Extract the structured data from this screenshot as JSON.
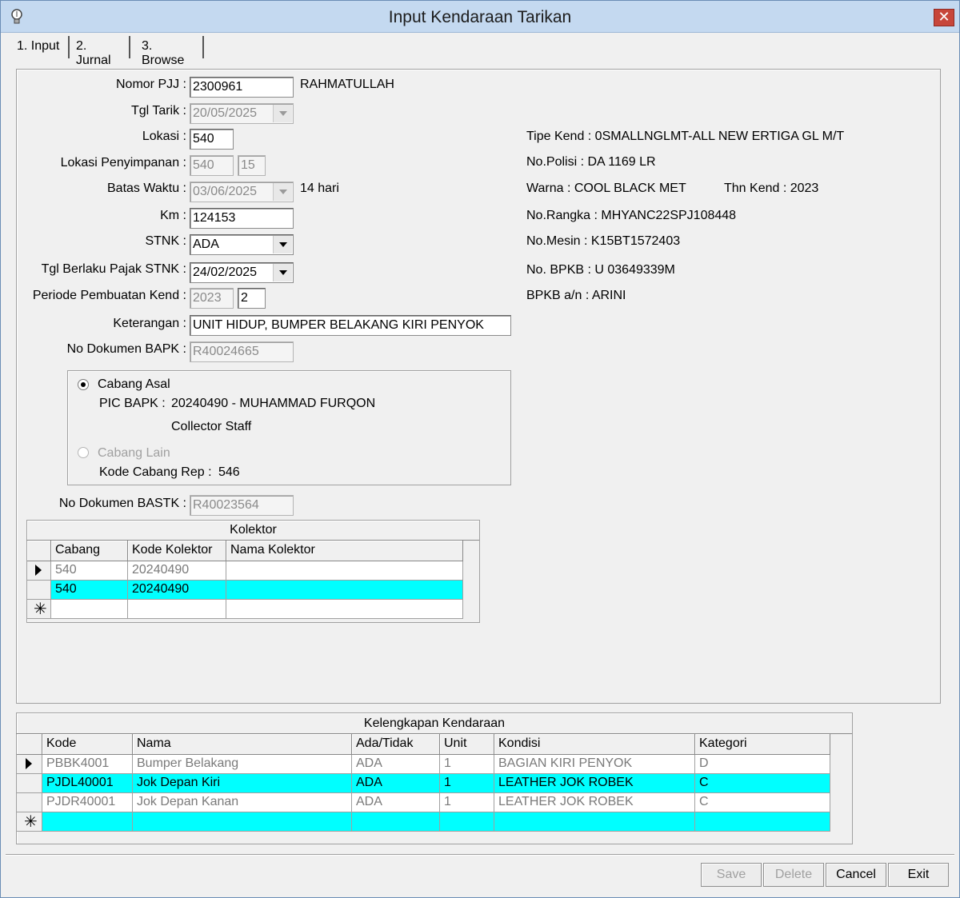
{
  "window": {
    "title": "Input Kendaraan Tarikan",
    "close_glyph": "✕"
  },
  "tabs": [
    {
      "label": "1. Input",
      "active": true
    },
    {
      "label": "2. Jurnal",
      "active": false
    },
    {
      "label": "3. Browse",
      "active": false
    }
  ],
  "form": {
    "nomor_pjj": {
      "label": "Nomor PJJ :",
      "value": "2300961",
      "name": "RAHMATULLAH"
    },
    "tgl_tarik": {
      "label": "Tgl Tarik :",
      "value": "20/05/2025"
    },
    "lokasi": {
      "label": "Lokasi :",
      "value": "540"
    },
    "lokasi_penyimpanan": {
      "label": "Lokasi Penyimpanan :",
      "value1": "540",
      "value2": "15"
    },
    "batas_waktu": {
      "label": "Batas Waktu :",
      "value": "03/06/2025",
      "note": "14 hari"
    },
    "km": {
      "label": "Km :",
      "value": "124153"
    },
    "stnk": {
      "label": "STNK :",
      "value": "ADA"
    },
    "tgl_berlaku_pajak": {
      "label": "Tgl Berlaku Pajak STNK :",
      "value": "24/02/2025"
    },
    "periode_pembuatan": {
      "label": "Periode Pembuatan Kend :",
      "value1": "2023",
      "value2": "2"
    },
    "keterangan": {
      "label": "Keterangan :",
      "value": "UNIT HIDUP, BUMPER BELAKANG KIRI PENYOK"
    },
    "no_dok_bapk": {
      "label": "No Dokumen BAPK :",
      "value": "R40024665"
    },
    "no_dok_bastk": {
      "label": "No Dokumen BASTK :",
      "value": "R40023564"
    }
  },
  "cabang_group": {
    "cabang_asal_label": "Cabang Asal",
    "pic_bapk_label": "PIC BAPK :",
    "pic_bapk_value": "20240490 - MUHAMMAD FURQON",
    "pic_role": "Collector Staff",
    "cabang_lain_label": "Cabang Lain",
    "kode_cabang_rep_label": "Kode Cabang Rep :",
    "kode_cabang_rep_value": "546"
  },
  "vehicle_info": {
    "tipe_kend": "Tipe Kend : 0SMALLNGLMT-ALL NEW ERTIGA GL M/T",
    "no_polisi": "No.Polisi : DA 1169 LR",
    "warna": "Warna : COOL BLACK MET",
    "thn_kend": "Thn Kend : 2023",
    "no_rangka": "No.Rangka : MHYANC22SPJ108448",
    "no_mesin": "No.Mesin : K15BT1572403",
    "no_bpkb": "No. BPKB : U 03649339M",
    "bpkb_an": "BPKB a/n : ARINI"
  },
  "kolektor": {
    "title": "Kolektor",
    "headers": [
      "Cabang",
      "Kode Kolektor",
      "Nama Kolektor"
    ],
    "rows": [
      [
        "540",
        "20240490",
        ""
      ],
      [
        "540",
        "20240490",
        ""
      ]
    ]
  },
  "kelengkapan": {
    "title": "Kelengkapan Kendaraan",
    "headers": [
      "Kode",
      "Nama",
      "Ada/Tidak",
      "Unit",
      "Kondisi",
      "Kategori"
    ],
    "rows": [
      [
        "PBBK4001",
        "Bumper Belakang",
        "ADA",
        "1",
        "BAGIAN KIRI PENYOK",
        "D"
      ],
      [
        "PJDL40001",
        "Jok Depan Kiri",
        "ADA",
        "1",
        "LEATHER JOK ROBEK",
        "C"
      ],
      [
        "PJDR40001",
        "Jok Depan Kanan",
        "ADA",
        "1",
        "LEATHER JOK ROBEK",
        "C"
      ]
    ]
  },
  "new_row_glyph": "✳",
  "buttons": {
    "save": "Save",
    "delete": "Delete",
    "cancel": "Cancel",
    "exit": "Exit"
  }
}
